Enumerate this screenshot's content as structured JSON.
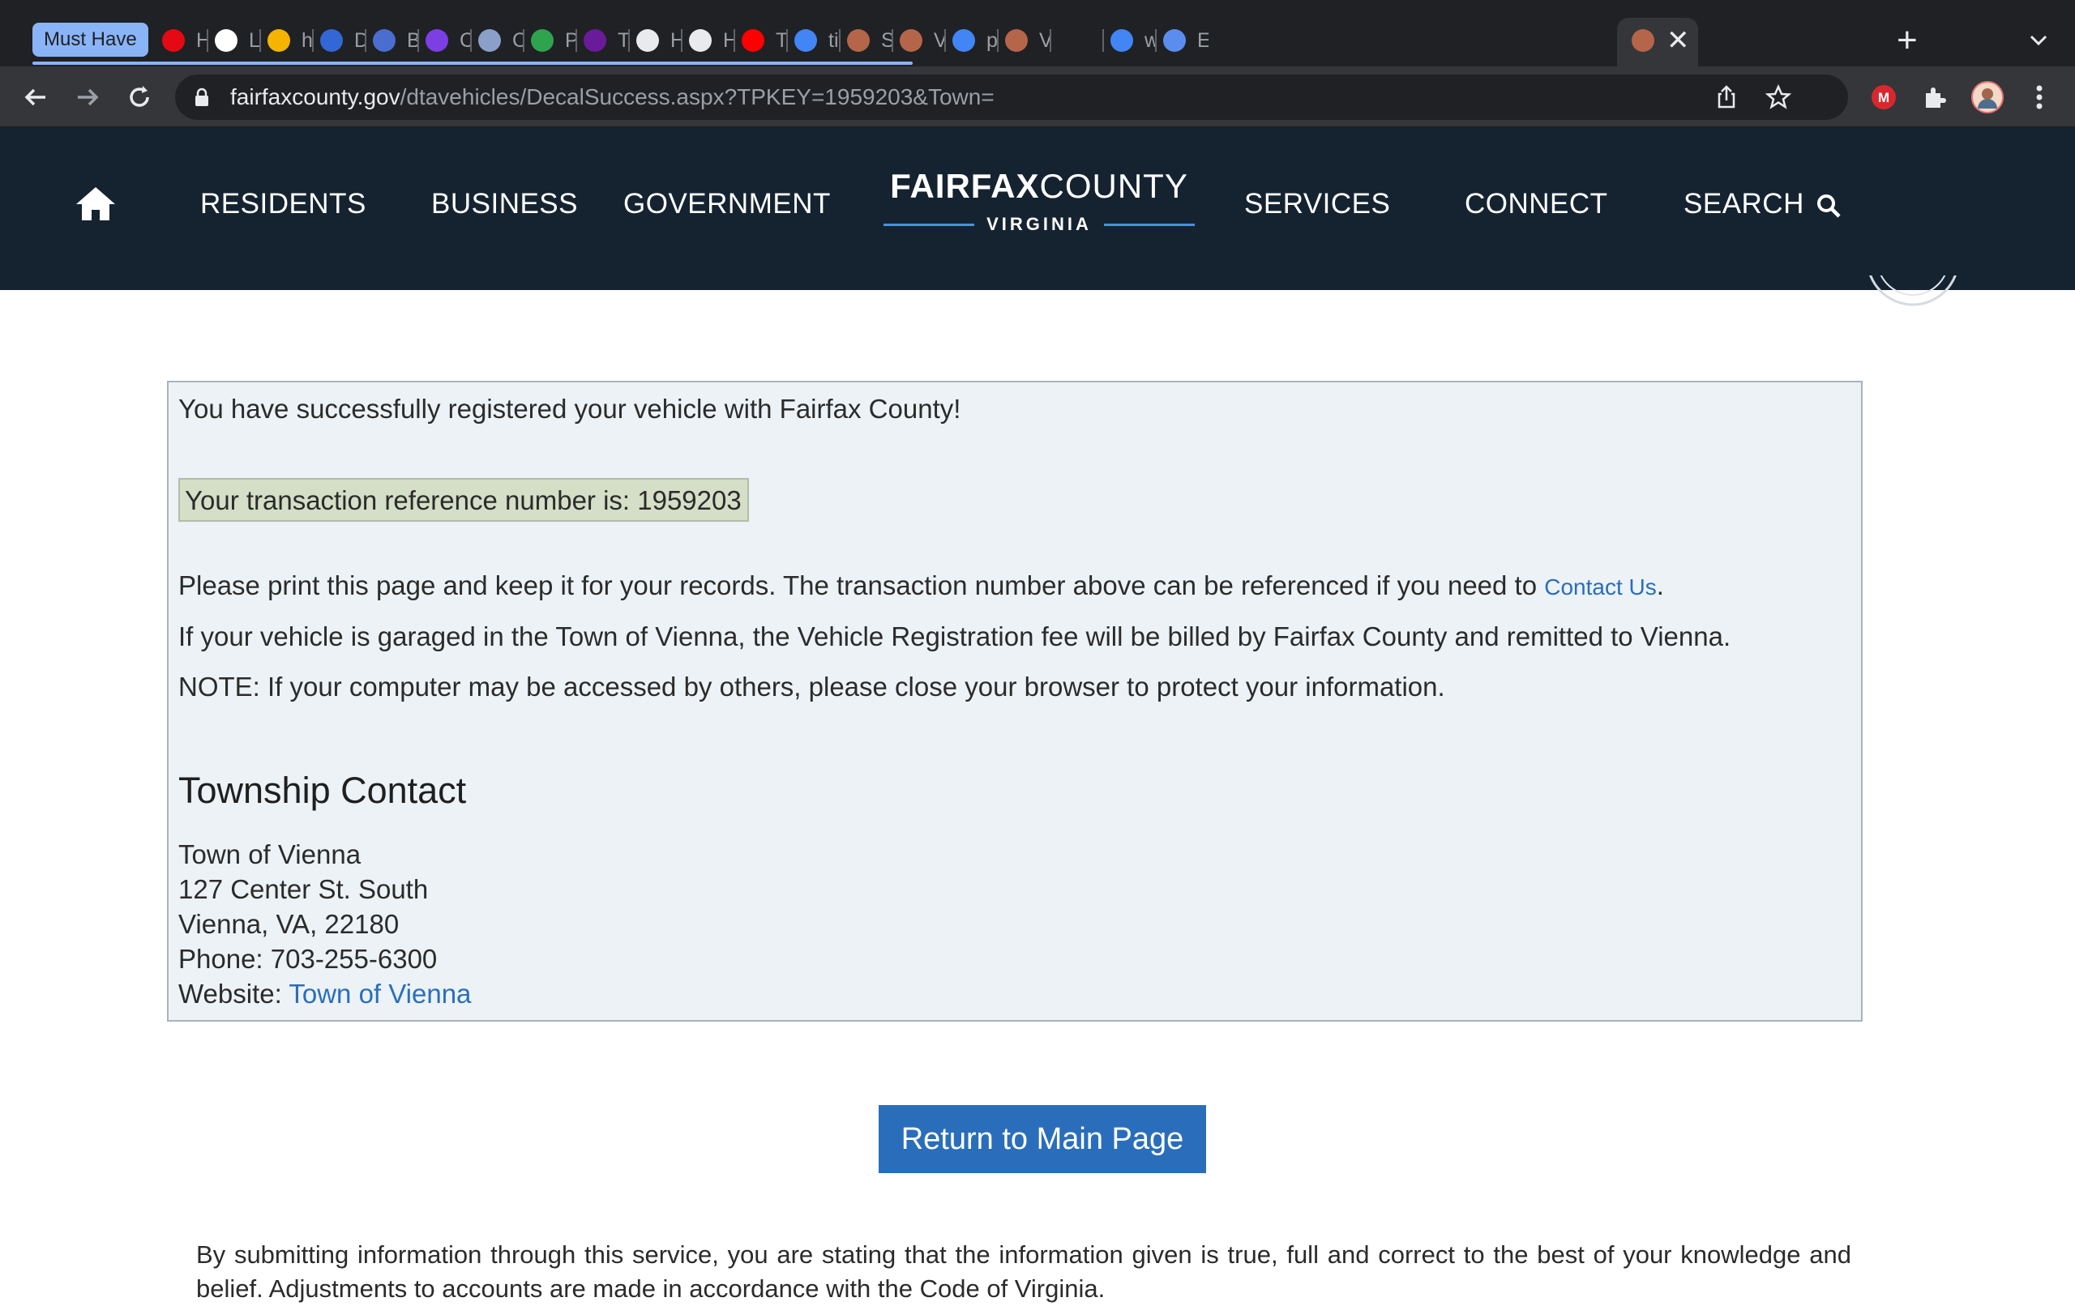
{
  "browser": {
    "tab_group_label": "Must Have",
    "tabs": [
      {
        "label": "Ho",
        "icon": "netflix-icon",
        "color": "#e50914"
      },
      {
        "label": "Lo",
        "icon": "medium-icon",
        "color": "#ffffff"
      },
      {
        "label": "htt",
        "icon": "chrome-ring-icon",
        "color": "#f4b400"
      },
      {
        "label": "Dc",
        "icon": "stripes-icon",
        "color": "#3367d6"
      },
      {
        "label": "Blu",
        "icon": "globe-icon",
        "color": "#4a6ed0"
      },
      {
        "label": "Cc",
        "icon": "u-badge-icon",
        "color": "#7b3fe4"
      },
      {
        "label": "Cit",
        "icon": "seal-icon",
        "color": "#8aa0c8"
      },
      {
        "label": "Py",
        "icon": "w-icon",
        "color": "#2ea44f"
      },
      {
        "label": "To",
        "icon": "purple-app-icon",
        "color": "#6a1b9a"
      },
      {
        "label": "Ho",
        "icon": "doc-face-icon",
        "color": "#e8eaed"
      },
      {
        "label": "HT",
        "icon": "doc-face-icon",
        "color": "#e8eaed"
      },
      {
        "label": "Tit",
        "icon": "youtube-icon",
        "color": "#ff0000"
      },
      {
        "label": "tit",
        "icon": "google-icon",
        "color": "#4285f4"
      },
      {
        "label": "Se",
        "icon": "county-seal-icon",
        "color": "#b5654a"
      },
      {
        "label": "Ve",
        "icon": "county-seal-icon",
        "color": "#b5654a"
      },
      {
        "label": "pr",
        "icon": "google-icon",
        "color": "#4285f4"
      },
      {
        "label": "Ve",
        "icon": "county-seal-icon",
        "color": "#b5654a"
      },
      {
        "label": "",
        "icon": "county-seal-icon",
        "color": "#b5654a",
        "active": true
      },
      {
        "label": "we",
        "icon": "google-icon",
        "color": "#4285f4"
      },
      {
        "label": "EV",
        "icon": "chart-icon",
        "color": "#5b8def"
      }
    ],
    "url_host": "fairfaxcounty.gov",
    "url_path": "/dtavehicles/DecalSuccess.aspx?TPKEY=1959203&Town="
  },
  "site_nav": {
    "residents": "RESIDENTS",
    "business": "BUSINESS",
    "government": "GOVERNMENT",
    "logo_bold": "FAIRFAX",
    "logo_regular": "COUNTY",
    "logo_sub": "VIRGINIA",
    "services": "SERVICES",
    "connect": "CONNECT",
    "search": "SEARCH"
  },
  "confirmation": {
    "success_message": "You have successfully registered your vehicle with Fairfax County!",
    "reference_text": "Your transaction reference number is: 1959203",
    "print_note": "Please print this page and keep it for your records. The transaction number above can be referenced if you need to ",
    "contact_link": "Contact Us",
    "period": ".",
    "vienna_note": "If your vehicle is garaged in the Town of Vienna, the Vehicle Registration fee will be billed by Fairfax County and remitted to Vienna.",
    "security_note": "NOTE: If your computer may be accessed by others, please close your browser to protect your information."
  },
  "township": {
    "heading": "Township Contact",
    "name": "Town of Vienna",
    "street": "127 Center St. South",
    "city": "Vienna, VA, 22180",
    "phone": "Phone: 703-255-6300",
    "website_label": "Website: ",
    "website_link": "Town of Vienna"
  },
  "return_button": "Return to Main Page",
  "disclaimer": "By submitting information through this service, you are stating that the information given is true, full and correct to the best of your knowledge and belief. Adjustments to accounts are made in accordance with the Code of Virginia.",
  "colors": {
    "header_bg": "#152331",
    "accent_blue": "#2a6ebb",
    "panel_bg": "#ecf2f6",
    "reference_bg": "#d5dec6"
  }
}
